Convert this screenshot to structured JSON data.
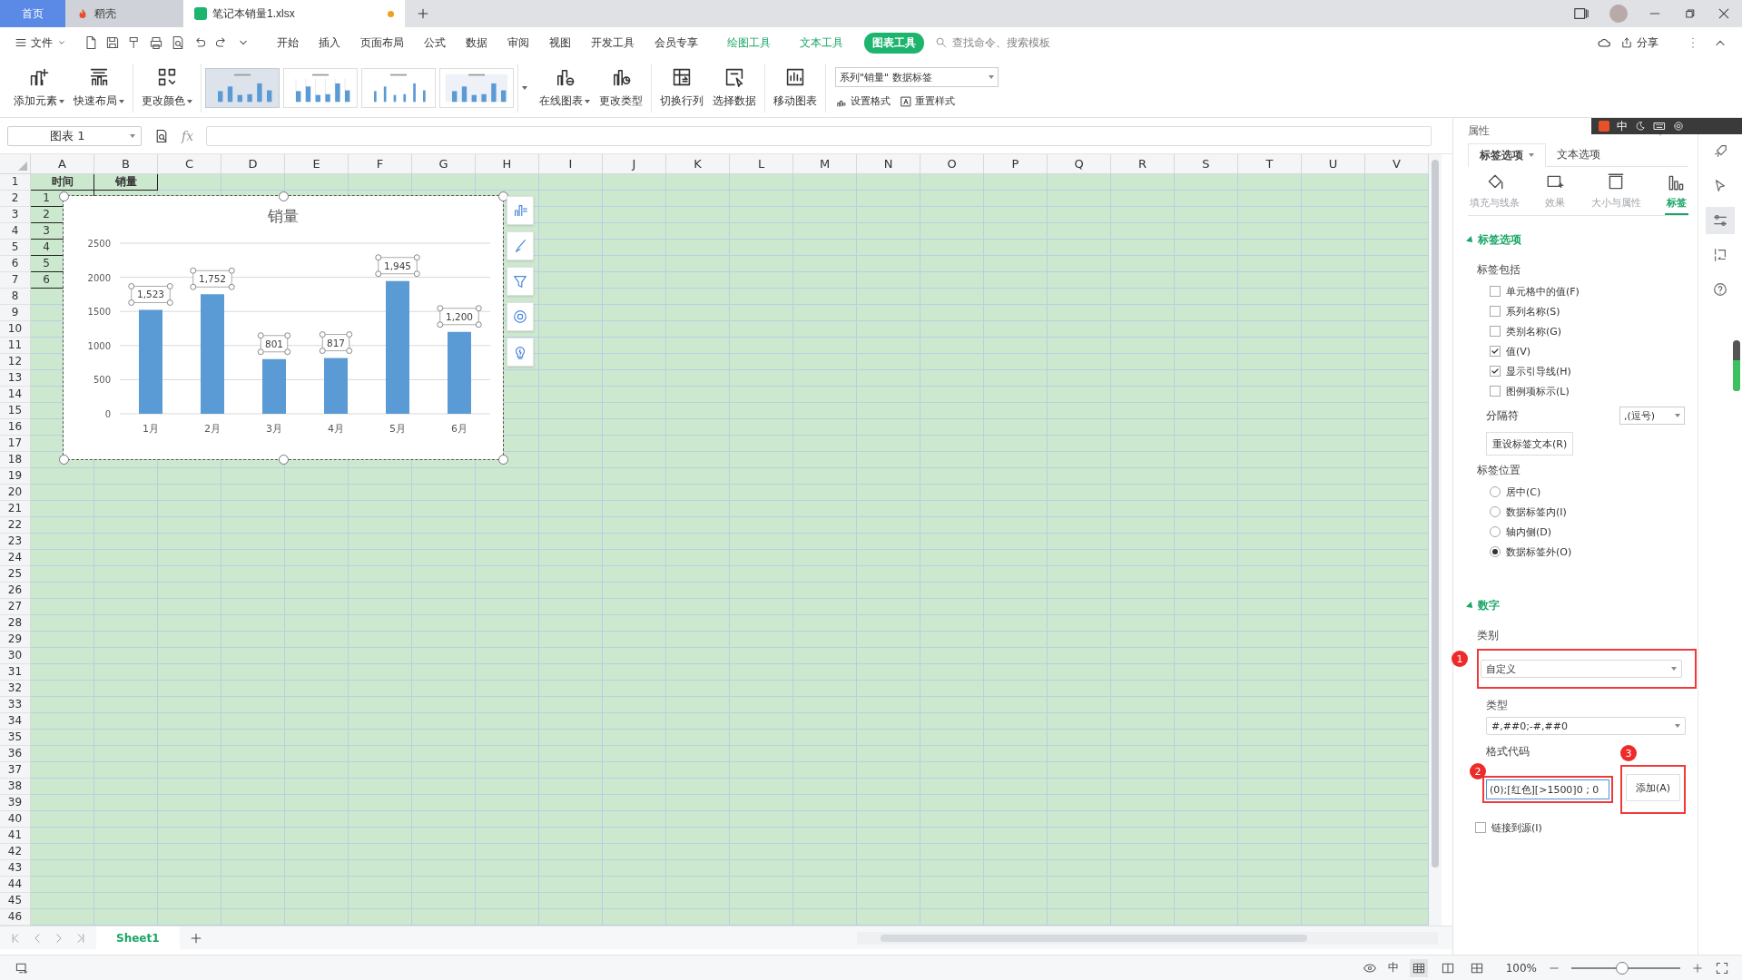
{
  "window_tabs": [
    {
      "label": "首页",
      "kind": "home",
      "selected": false,
      "unsaved": false
    },
    {
      "label": "稻壳",
      "kind": "docer",
      "selected": false,
      "unsaved": false
    },
    {
      "label": "笔记本销量1.xlsx",
      "kind": "workbook",
      "selected": true,
      "unsaved": true
    }
  ],
  "menu": {
    "file": "文件",
    "tabs": [
      {
        "label": "开始",
        "kind": "plain",
        "selected": false
      },
      {
        "label": "插入",
        "kind": "plain",
        "selected": false
      },
      {
        "label": "页面布局",
        "kind": "plain",
        "selected": false
      },
      {
        "label": "公式",
        "kind": "plain",
        "selected": false
      },
      {
        "label": "数据",
        "kind": "plain",
        "selected": false
      },
      {
        "label": "审阅",
        "kind": "plain",
        "selected": false
      },
      {
        "label": "视图",
        "kind": "plain",
        "selected": false
      },
      {
        "label": "开发工具",
        "kind": "plain",
        "selected": false
      },
      {
        "label": "会员专享",
        "kind": "plain",
        "selected": false
      },
      {
        "label": "绘图工具",
        "kind": "tool",
        "selected": false
      },
      {
        "label": "文本工具",
        "kind": "tool",
        "selected": false
      },
      {
        "label": "图表工具",
        "kind": "tool",
        "selected": true
      }
    ],
    "search": {
      "placeholder": "查找命令、搜索模板"
    },
    "share": "分享"
  },
  "ime": {
    "mode": "中"
  },
  "ribbon": {
    "left_groups": [
      [
        {
          "kind": "add-element",
          "label": "添加元素",
          "dropdown": true
        },
        {
          "kind": "quick-layout",
          "label": "快速布局",
          "dropdown": true
        }
      ],
      [
        {
          "kind": "change-color",
          "label": "更改颜色",
          "dropdown": true
        }
      ]
    ],
    "styles": [
      {
        "kind": "plain",
        "selected": true
      },
      {
        "kind": "grid",
        "selected": false
      },
      {
        "kind": "thin",
        "selected": false
      },
      {
        "kind": "shaded",
        "selected": false
      }
    ],
    "right_groups": [
      [
        {
          "kind": "online-chart",
          "label": "在线图表",
          "dropdown": true
        },
        {
          "kind": "change-type",
          "label": "更改类型",
          "dropdown": false
        }
      ],
      [
        {
          "kind": "switch",
          "label": "切换行列",
          "dropdown": false
        },
        {
          "kind": "select-data",
          "label": "选择数据",
          "dropdown": false
        }
      ],
      [
        {
          "kind": "move-chart",
          "label": "移动图表",
          "dropdown": false
        }
      ]
    ],
    "element_select": "系列\"销量\" 数据标签",
    "format_buttons": [
      {
        "kind": "set-format",
        "label": "设置格式"
      },
      {
        "kind": "reset-style",
        "label": "重置样式"
      }
    ]
  },
  "formula_bar": {
    "name_box": "图表 1",
    "fx": "fx"
  },
  "sheet": {
    "columns": [
      "A",
      "B",
      "C",
      "D",
      "E",
      "F",
      "G",
      "H",
      "I",
      "J",
      "K",
      "L",
      "M",
      "N",
      "O",
      "P",
      "Q",
      "R",
      "S",
      "T",
      "U",
      "V"
    ],
    "rows": [
      {
        "header": "1",
        "cells": [
          {
            "text": "时间",
            "bold": true,
            "bordered": true,
            "kind": "header"
          },
          {
            "text": "销量",
            "bold": true,
            "bordered": true,
            "kind": "header"
          }
        ]
      },
      {
        "header": "2",
        "cells": [
          {
            "text": "1",
            "bold": false,
            "bordered": true,
            "kind": "clipped"
          }
        ]
      },
      {
        "header": "3",
        "cells": [
          {
            "text": "2",
            "bold": false,
            "bordered": true,
            "kind": "clipped"
          }
        ]
      },
      {
        "header": "4",
        "cells": [
          {
            "text": "3",
            "bold": false,
            "bordered": true,
            "kind": "clipped"
          }
        ]
      },
      {
        "header": "5",
        "cells": [
          {
            "text": "4",
            "bold": false,
            "bordered": true,
            "kind": "clipped"
          }
        ]
      },
      {
        "header": "6",
        "cells": [
          {
            "text": "5",
            "bold": false,
            "bordered": true,
            "kind": "clipped"
          }
        ]
      },
      {
        "header": "7",
        "cells": [
          {
            "text": "6",
            "bold": false,
            "bordered": true,
            "kind": "clipped"
          }
        ]
      },
      {
        "header": "8"
      },
      {
        "header": "9"
      },
      {
        "header": "10"
      },
      {
        "header": "11"
      },
      {
        "header": "12"
      },
      {
        "header": "13"
      },
      {
        "header": "14"
      },
      {
        "header": "15"
      },
      {
        "header": "16"
      },
      {
        "header": "17"
      },
      {
        "header": "18"
      },
      {
        "header": "19"
      },
      {
        "header": "20"
      },
      {
        "header": "21"
      },
      {
        "header": "22"
      },
      {
        "header": "23"
      },
      {
        "header": "24"
      },
      {
        "header": "25"
      },
      {
        "header": "26"
      },
      {
        "header": "27"
      },
      {
        "header": "28"
      },
      {
        "header": "29"
      },
      {
        "header": "30"
      },
      {
        "header": "31"
      },
      {
        "header": "32"
      },
      {
        "header": "33"
      },
      {
        "header": "34"
      },
      {
        "header": "35"
      },
      {
        "header": "36"
      },
      {
        "header": "37"
      },
      {
        "header": "38"
      },
      {
        "header": "39"
      },
      {
        "header": "40"
      },
      {
        "header": "41"
      },
      {
        "header": "42"
      },
      {
        "header": "43"
      },
      {
        "header": "44"
      },
      {
        "header": "45"
      },
      {
        "header": "46"
      }
    ],
    "chart": {
      "selected": true,
      "chart_data": {
        "type": "bar",
        "title": "销量",
        "categories": [
          "1月",
          "2月",
          "3月",
          "4月",
          "5月",
          "6月"
        ],
        "series": [
          {
            "color": "#5b9bd5",
            "values": [
              1523,
              1752,
              801,
              817,
              1945,
              1200
            ]
          }
        ],
        "ylim": [
          0,
          2500
        ],
        "yticks": [
          0,
          500,
          1000,
          1500,
          2000,
          2500
        ],
        "grid": true,
        "value_labels": [
          "1,523",
          "1,752",
          "801",
          "817",
          "1,945",
          "1,200"
        ]
      },
      "tools": [
        {
          "kind": "elements"
        },
        {
          "kind": "style"
        },
        {
          "kind": "filter"
        },
        {
          "kind": "settings"
        },
        {
          "kind": "idea"
        }
      ]
    }
  },
  "sheet_tabs": [
    {
      "label": "Sheet1",
      "selected": true
    }
  ],
  "panel": {
    "title": "属性",
    "tabs": [
      {
        "label": "标签选项",
        "selected": true,
        "dropdown": true
      },
      {
        "label": "文本选项",
        "selected": false,
        "dropdown": false
      }
    ],
    "subtabs": [
      {
        "kind": "fill",
        "label": "填充与线条",
        "selected": false
      },
      {
        "kind": "effect",
        "label": "效果",
        "selected": false
      },
      {
        "kind": "size",
        "label": "大小与属性",
        "selected": false
      },
      {
        "kind": "label",
        "label": "标签",
        "selected": true
      }
    ],
    "label_section": {
      "title": "标签选项",
      "expanded": true,
      "include_label": "标签包括",
      "include": [
        {
          "label": "单元格中的值(F)",
          "checked": false
        },
        {
          "label": "系列名称(S)",
          "checked": false
        },
        {
          "label": "类别名称(G)",
          "checked": false
        },
        {
          "label": "值(V)",
          "checked": true
        },
        {
          "label": "显示引导线(H)",
          "checked": true
        },
        {
          "label": "图例项标示(L)",
          "checked": false
        }
      ],
      "separator": {
        "label": "分隔符",
        "value": ",(逗号)"
      },
      "reset_button": "重设标签文本(R)",
      "position_label": "标签位置",
      "positions": [
        {
          "label": "居中(C)",
          "selected": false
        },
        {
          "label": "数据标签内(I)",
          "selected": false
        },
        {
          "label": "轴内侧(D)",
          "selected": false
        },
        {
          "label": "数据标签外(O)",
          "selected": true
        }
      ]
    },
    "number_section": {
      "title": "数字",
      "expanded": true,
      "category": {
        "label": "类别",
        "value": "自定义",
        "step": "1"
      },
      "type": {
        "label": "类型",
        "value": "#,##0;-#,##0"
      },
      "format_code": {
        "label": "格式代码",
        "value": "(0);[红色][>1500]0 ; 0",
        "step": "2"
      },
      "add_button": {
        "label": "添加(A)",
        "step": "3"
      },
      "link_source": {
        "label": "链接到源(I)",
        "checked": false
      }
    }
  },
  "side_strip": [
    {
      "kind": "rocket",
      "selected": false
    },
    {
      "kind": "pointer",
      "selected": false
    },
    {
      "kind": "sliders",
      "selected": true
    },
    {
      "kind": "swap",
      "selected": false
    },
    {
      "kind": "help",
      "selected": false
    }
  ],
  "status_bar": {
    "input_mode": "中",
    "views": [
      {
        "kind": "normal",
        "selected": true
      },
      {
        "kind": "page",
        "selected": false
      },
      {
        "kind": "break",
        "selected": false
      }
    ],
    "zoom": "100%",
    "zoom_slider": {
      "level": 0.47
    }
  }
}
